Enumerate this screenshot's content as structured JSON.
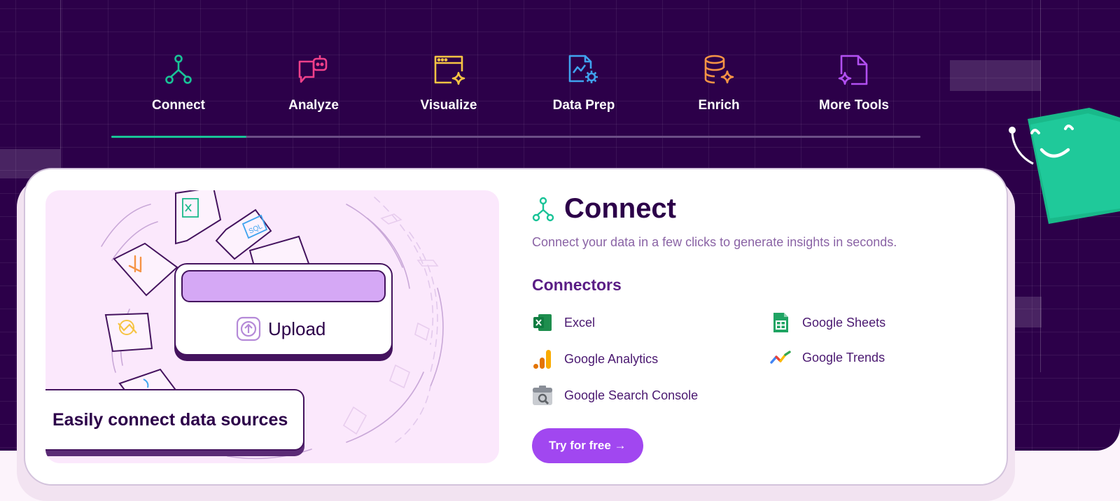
{
  "tabs": [
    {
      "label": "Connect",
      "icon": "connect-network-icon",
      "color": "#19c397",
      "active": true
    },
    {
      "label": "Analyze",
      "icon": "chat-bot-icon",
      "color": "#f0408a",
      "active": false
    },
    {
      "label": "Visualize",
      "icon": "browser-sparkle-icon",
      "color": "#f6c443",
      "active": false
    },
    {
      "label": "Data Prep",
      "icon": "chart-gear-icon",
      "color": "#3fa3ef",
      "active": false
    },
    {
      "label": "Enrich",
      "icon": "database-sparkle-icon",
      "color": "#f59345",
      "active": false
    },
    {
      "label": "More Tools",
      "icon": "file-sparkle-icon",
      "color": "#b24ff2",
      "active": false
    }
  ],
  "tab_progress": 0.1667,
  "illustration": {
    "upload_label": "Upload",
    "caption": "Easily connect data sources",
    "file_badges": [
      "SQL"
    ]
  },
  "panel": {
    "title": "Connect",
    "subtitle": "Connect your data in a few clicks to generate insights in seconds.",
    "connectors_heading": "Connectors",
    "connectors": [
      {
        "label": "Excel",
        "icon": "excel-icon"
      },
      {
        "label": "Google Sheets",
        "icon": "google-sheets-icon"
      },
      {
        "label": "Google Analytics",
        "icon": "google-analytics-icon"
      },
      {
        "label": "Google Trends",
        "icon": "google-trends-icon"
      },
      {
        "label": "Google Search Console",
        "icon": "google-search-console-icon"
      }
    ],
    "cta_label": "Try for free →"
  },
  "colors": {
    "hero_bg": "#2c0049",
    "accent_green": "#19c397",
    "cta_purple": "#a147f0",
    "heading": "#2c0049"
  }
}
